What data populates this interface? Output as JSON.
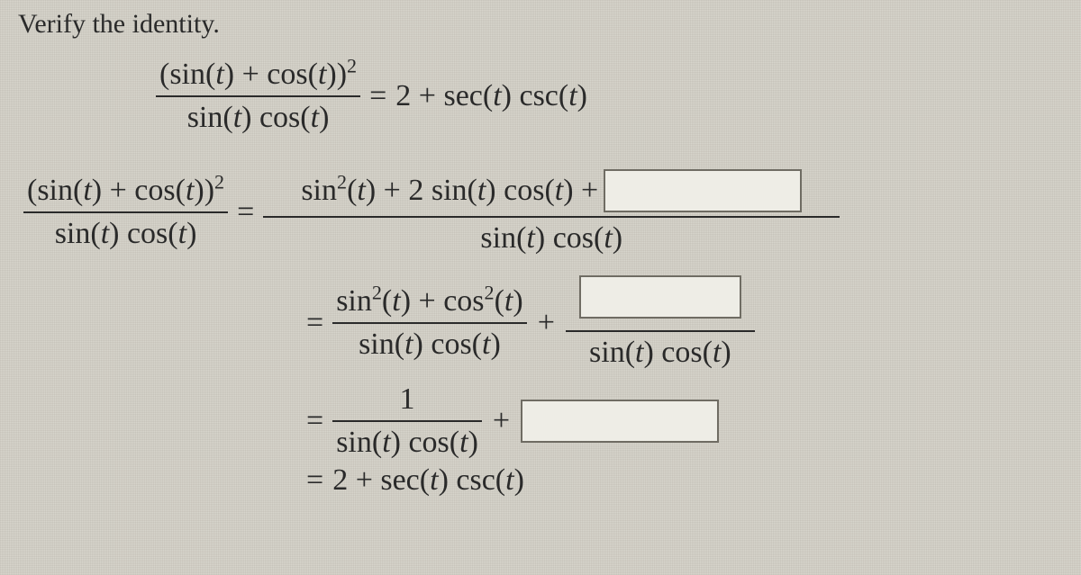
{
  "heading": "Verify the identity.",
  "identity": {
    "lhs_num": "(sin(t) + cos(t))²",
    "lhs_den": "sin(t) cos(t)",
    "rhs": "2 + sec(t) csc(t)"
  },
  "step1": {
    "lhs_num": "(sin(t) + cos(t))²",
    "lhs_den": "sin(t) cos(t)",
    "rhs_num_prefix": "sin²(t) + 2 sin(t) cos(t) + ",
    "rhs_den": "sin(t) cos(t)"
  },
  "step2": {
    "frac_num": "sin²(t) + cos²(t)",
    "frac_den": "sin(t) cos(t)",
    "plus_frac_den": "sin(t) cos(t)"
  },
  "step3": {
    "frac_num": "1",
    "frac_den": "sin(t) cos(t)"
  },
  "step4": {
    "rhs": "2 + sec(t) csc(t)"
  },
  "symbols": {
    "equals": "=",
    "plus": "+"
  }
}
